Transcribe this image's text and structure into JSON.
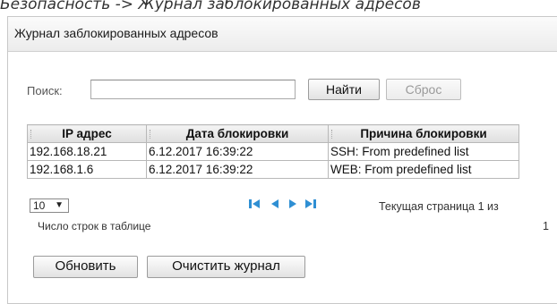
{
  "doc_caption": "Безопасность -> Журнал заблокированных адресов",
  "panel": {
    "title": "Журнал заблокированных адресов"
  },
  "search": {
    "label": "Поиск:",
    "value": "",
    "placeholder": ""
  },
  "buttons": {
    "find": "Найти",
    "reset": "Сброс",
    "refresh": "Обновить",
    "clear_log": "Очистить журнал"
  },
  "table": {
    "columns": [
      "IP адрес",
      "Дата блокировки",
      "Причина блокировки"
    ],
    "rows": [
      {
        "ip": "192.168.18.21",
        "date": "6.12.2017 16:39:22",
        "reason": "SSH: From predefined list"
      },
      {
        "ip": "192.168.1.6",
        "date": "6.12.2017 16:39:22",
        "reason": "WEB: From predefined list"
      }
    ]
  },
  "pager": {
    "rows_per_page": "10",
    "rows_label": "Число строк в таблице",
    "status": "Текущая страница 1 из",
    "total_pages": "1"
  },
  "colors": {
    "nav_icon": "#2f8fd3"
  }
}
